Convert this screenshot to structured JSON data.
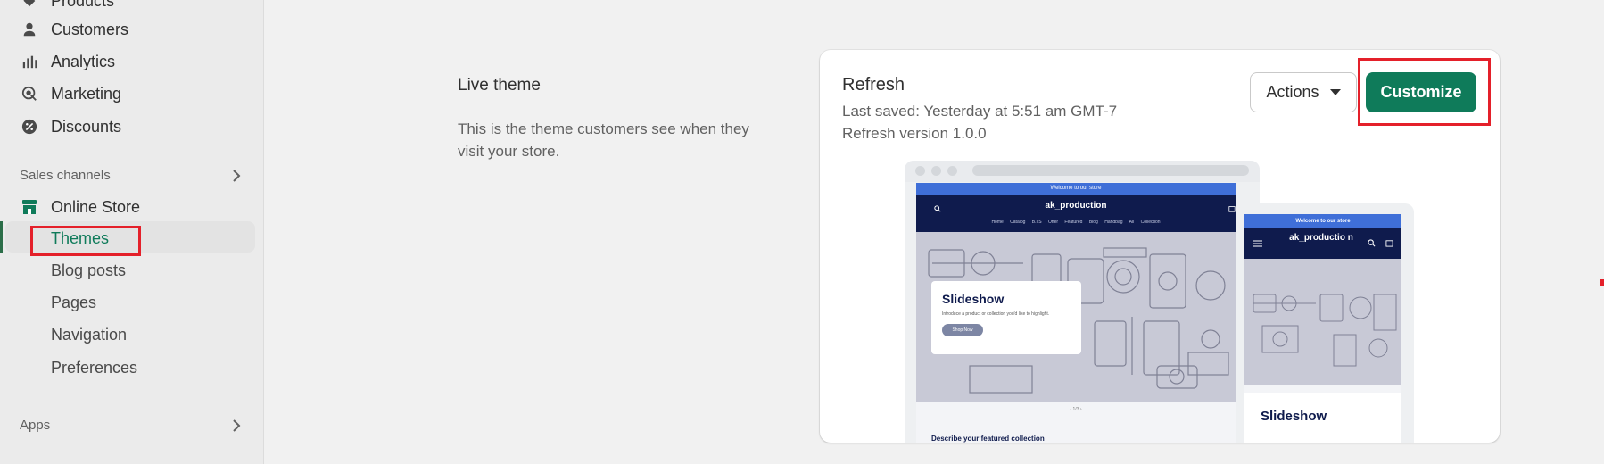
{
  "sidebar": {
    "items": [
      {
        "label": "Products",
        "icon": "tag-icon"
      },
      {
        "label": "Customers",
        "icon": "person-icon"
      },
      {
        "label": "Analytics",
        "icon": "bar-chart-icon"
      },
      {
        "label": "Marketing",
        "icon": "target-icon"
      },
      {
        "label": "Discounts",
        "icon": "discount-icon"
      }
    ],
    "sales_channels_label": "Sales channels",
    "online_store": {
      "label": "Online Store",
      "icon": "store-icon"
    },
    "sub_items": [
      "Themes",
      "Blog posts",
      "Pages",
      "Navigation",
      "Preferences"
    ],
    "apps_label": "Apps"
  },
  "live_theme": {
    "title": "Live theme",
    "description": "This is the theme customers see when they visit your store."
  },
  "theme_card": {
    "name": "Refresh",
    "last_saved": "Last saved: Yesterday at 5:51 am GMT-7",
    "version": "Refresh version 1.0.0",
    "actions_label": "Actions",
    "customize_label": "Customize",
    "accent_color": "#0f7b5a"
  },
  "preview": {
    "announcement": "Welcome to our store",
    "store_name": "ak_production",
    "nav_links": "Home Catalog B.I.S Offer Featured Blog Handbag All Collection",
    "slideshow_title": "Slideshow",
    "slideshow_sub": "Introduce a product or collection you'd like to highlight.",
    "shop_now": "Shop Now",
    "pager": "‹ 1/3 ›",
    "featured": "Describe your featured collection",
    "mobile_store_name": "ak_productio n",
    "mobile_slideshow_title": "Slideshow"
  }
}
